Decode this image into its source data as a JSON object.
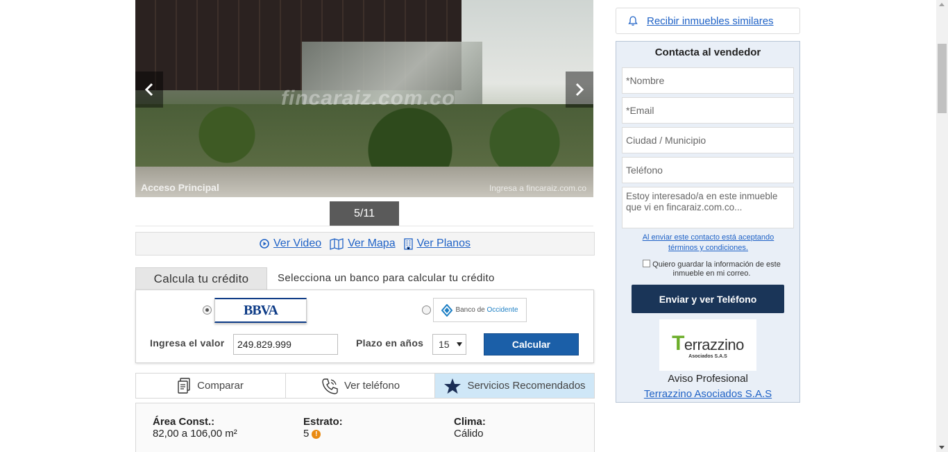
{
  "gallery": {
    "watermark": "fincaraiz.com.co",
    "caption": "Acceso Principal",
    "bottom_watermark": "Ingresa a fincaraiz.com.co",
    "counter": "5/11"
  },
  "media_links": [
    {
      "label": "Ver Video",
      "icon": "play-circle-icon"
    },
    {
      "label": "Ver Mapa",
      "icon": "map-icon"
    },
    {
      "label": "Ver Planos",
      "icon": "building-icon"
    }
  ],
  "credit": {
    "tab_label": "Calcula tu crédito",
    "subtitle": "Selecciona un banco para calcular tu crédito",
    "banks": [
      {
        "name": "BBVA",
        "selected": true
      },
      {
        "name": "Banco de Occidente",
        "name_part1": "Banco de",
        "name_part2": "Occidente",
        "selected": false
      }
    ],
    "value_label": "Ingresa el valor",
    "value": "249.829.999",
    "term_label": "Plazo en años",
    "term_value": "15",
    "calculate_label": "Calcular"
  },
  "actions": [
    {
      "label": "Comparar",
      "icon": "compare-icon"
    },
    {
      "label": "Ver teléfono",
      "icon": "phone-icon"
    },
    {
      "label": "Servicios Recomendados",
      "icon": "star-icon"
    }
  ],
  "features": [
    {
      "title": "Área Const.:",
      "value": "82,00 a 106,00 m²"
    },
    {
      "title": "Estrato:",
      "value": "5"
    },
    {
      "title": "Clima:",
      "value": "Cálido"
    }
  ],
  "sidebar": {
    "similar_label": "Recibir inmuebles similares",
    "contact_title": "Contacta al vendedor",
    "fields": {
      "name_placeholder": "*Nombre",
      "email_placeholder": "*Email",
      "city_placeholder": "Ciudad / Municipio",
      "phone_placeholder": "Teléfono",
      "message_placeholder": "Estoy interesado/a en este inmueble que vi en fincaraiz.com.co..."
    },
    "terms_text": "Al enviar este contacto está aceptando términos y condiciones.",
    "save_text": "Quiero guardar la información de este inmueble en mi correo.",
    "send_label": "Enviar y ver Teléfono",
    "logo_text": "errazzino",
    "logo_sub": "Asociados S.A.S",
    "aviso": "Aviso Profesional",
    "agency": "Terrazzino Asociados S.A.S"
  },
  "colors": {
    "link": "#1f62c6",
    "primary_button": "#1a3558",
    "calc_button": "#1b5fa8",
    "highlight_tab": "#cfe7f7"
  }
}
